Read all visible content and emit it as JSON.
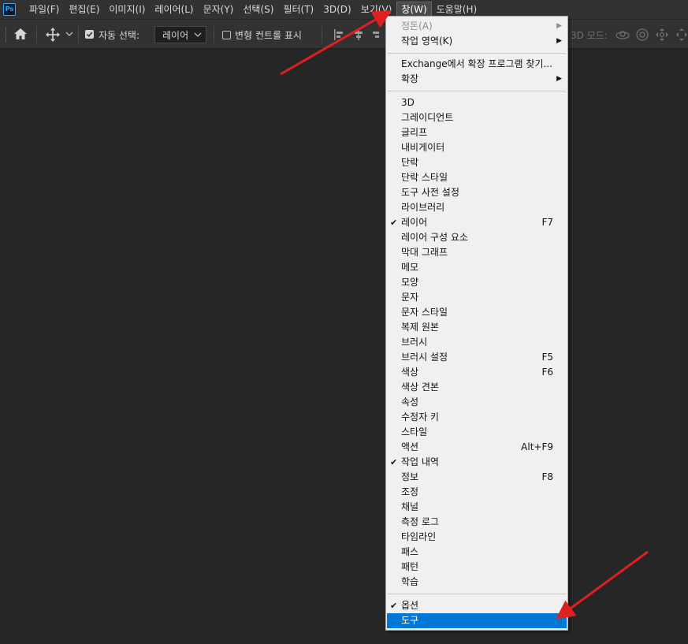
{
  "app": {
    "logo_text": "Ps"
  },
  "menubar": {
    "items": [
      {
        "label": "파일(F)"
      },
      {
        "label": "편집(E)"
      },
      {
        "label": "이미지(I)"
      },
      {
        "label": "레이어(L)"
      },
      {
        "label": "문자(Y)"
      },
      {
        "label": "선택(S)"
      },
      {
        "label": "필터(T)"
      },
      {
        "label": "3D(D)"
      },
      {
        "label": "보기(V)"
      },
      {
        "label": "창(W)"
      },
      {
        "label": "도움말(H)"
      }
    ],
    "active_index": 9
  },
  "options_bar": {
    "auto_select_label": "자동 선택:",
    "auto_select_checked": true,
    "auto_select_value": "레이어",
    "transform_controls_label": "변형 컨트롤 표시",
    "transform_controls_checked": false,
    "mode_3d_label": "3D 모드:"
  },
  "window_menu": {
    "items": [
      {
        "label": "정돈(A)",
        "shortcut": "",
        "checked": false,
        "submenu": true,
        "disabled": true,
        "selected": false
      },
      {
        "label": "작업 영역(K)",
        "shortcut": "",
        "checked": false,
        "submenu": true,
        "disabled": false,
        "selected": false
      },
      {
        "label": "Exchange에서 확장 프로그램 찾기...",
        "shortcut": "",
        "checked": false,
        "submenu": false,
        "disabled": false,
        "selected": false
      },
      {
        "label": "확장",
        "shortcut": "",
        "checked": false,
        "submenu": true,
        "disabled": false,
        "selected": false
      },
      {
        "label": "3D",
        "shortcut": "",
        "checked": false,
        "submenu": false,
        "disabled": false,
        "selected": false
      },
      {
        "label": "그레이디언트",
        "shortcut": "",
        "checked": false,
        "submenu": false,
        "disabled": false,
        "selected": false
      },
      {
        "label": "글리프",
        "shortcut": "",
        "checked": false,
        "submenu": false,
        "disabled": false,
        "selected": false
      },
      {
        "label": "내비게이터",
        "shortcut": "",
        "checked": false,
        "submenu": false,
        "disabled": false,
        "selected": false
      },
      {
        "label": "단락",
        "shortcut": "",
        "checked": false,
        "submenu": false,
        "disabled": false,
        "selected": false
      },
      {
        "label": "단락 스타일",
        "shortcut": "",
        "checked": false,
        "submenu": false,
        "disabled": false,
        "selected": false
      },
      {
        "label": "도구 사전 설정",
        "shortcut": "",
        "checked": false,
        "submenu": false,
        "disabled": false,
        "selected": false
      },
      {
        "label": "라이브러리",
        "shortcut": "",
        "checked": false,
        "submenu": false,
        "disabled": false,
        "selected": false
      },
      {
        "label": "레이어",
        "shortcut": "F7",
        "checked": true,
        "submenu": false,
        "disabled": false,
        "selected": false
      },
      {
        "label": "레이어 구성 요소",
        "shortcut": "",
        "checked": false,
        "submenu": false,
        "disabled": false,
        "selected": false
      },
      {
        "label": "막대 그래프",
        "shortcut": "",
        "checked": false,
        "submenu": false,
        "disabled": false,
        "selected": false
      },
      {
        "label": "메모",
        "shortcut": "",
        "checked": false,
        "submenu": false,
        "disabled": false,
        "selected": false
      },
      {
        "label": "모양",
        "shortcut": "",
        "checked": false,
        "submenu": false,
        "disabled": false,
        "selected": false
      },
      {
        "label": "문자",
        "shortcut": "",
        "checked": false,
        "submenu": false,
        "disabled": false,
        "selected": false
      },
      {
        "label": "문자 스타일",
        "shortcut": "",
        "checked": false,
        "submenu": false,
        "disabled": false,
        "selected": false
      },
      {
        "label": "복제 원본",
        "shortcut": "",
        "checked": false,
        "submenu": false,
        "disabled": false,
        "selected": false
      },
      {
        "label": "브러시",
        "shortcut": "",
        "checked": false,
        "submenu": false,
        "disabled": false,
        "selected": false
      },
      {
        "label": "브러시 설정",
        "shortcut": "F5",
        "checked": false,
        "submenu": false,
        "disabled": false,
        "selected": false
      },
      {
        "label": "색상",
        "shortcut": "F6",
        "checked": false,
        "submenu": false,
        "disabled": false,
        "selected": false
      },
      {
        "label": "색상 견본",
        "shortcut": "",
        "checked": false,
        "submenu": false,
        "disabled": false,
        "selected": false
      },
      {
        "label": "속성",
        "shortcut": "",
        "checked": false,
        "submenu": false,
        "disabled": false,
        "selected": false
      },
      {
        "label": "수정자 키",
        "shortcut": "",
        "checked": false,
        "submenu": false,
        "disabled": false,
        "selected": false
      },
      {
        "label": "스타일",
        "shortcut": "",
        "checked": false,
        "submenu": false,
        "disabled": false,
        "selected": false
      },
      {
        "label": "액션",
        "shortcut": "Alt+F9",
        "checked": false,
        "submenu": false,
        "disabled": false,
        "selected": false
      },
      {
        "label": "작업 내역",
        "shortcut": "",
        "checked": true,
        "submenu": false,
        "disabled": false,
        "selected": false
      },
      {
        "label": "정보",
        "shortcut": "F8",
        "checked": false,
        "submenu": false,
        "disabled": false,
        "selected": false
      },
      {
        "label": "조정",
        "shortcut": "",
        "checked": false,
        "submenu": false,
        "disabled": false,
        "selected": false
      },
      {
        "label": "채널",
        "shortcut": "",
        "checked": false,
        "submenu": false,
        "disabled": false,
        "selected": false
      },
      {
        "label": "측정 로그",
        "shortcut": "",
        "checked": false,
        "submenu": false,
        "disabled": false,
        "selected": false
      },
      {
        "label": "타임라인",
        "shortcut": "",
        "checked": false,
        "submenu": false,
        "disabled": false,
        "selected": false
      },
      {
        "label": "패스",
        "shortcut": "",
        "checked": false,
        "submenu": false,
        "disabled": false,
        "selected": false
      },
      {
        "label": "패턴",
        "shortcut": "",
        "checked": false,
        "submenu": false,
        "disabled": false,
        "selected": false
      },
      {
        "label": "학습",
        "shortcut": "",
        "checked": false,
        "submenu": false,
        "disabled": false,
        "selected": false
      },
      {
        "label": "옵션",
        "shortcut": "",
        "checked": true,
        "submenu": false,
        "disabled": false,
        "selected": false
      },
      {
        "label": "도구",
        "shortcut": "",
        "checked": false,
        "submenu": false,
        "disabled": false,
        "selected": true
      }
    ]
  },
  "colors": {
    "canvas_bg": "#262626",
    "bar_bg": "#323232",
    "menu_bg": "#f0f0f0",
    "highlight": "#0078d7",
    "annotation_arrow": "#e02020"
  }
}
